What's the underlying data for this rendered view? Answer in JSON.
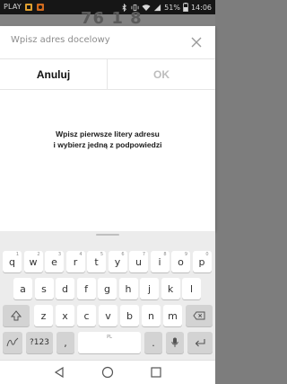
{
  "status_bar": {
    "carrier": "PLAY",
    "battery": "51%",
    "time": "14:06"
  },
  "background_app": {
    "partial_text": "76 1 8"
  },
  "dialog": {
    "input_placeholder": "Wpisz adres docelowy",
    "input_value": "",
    "cancel_label": "Anuluj",
    "ok_label": "OK",
    "hint_line1": "Wpisz pierwsze litery adresu",
    "hint_line2": "i wybierz jedną z podpowiedzi"
  },
  "keyboard": {
    "row1": [
      {
        "k": "q",
        "n": "1"
      },
      {
        "k": "w",
        "n": "2"
      },
      {
        "k": "e",
        "n": "3"
      },
      {
        "k": "r",
        "n": "4"
      },
      {
        "k": "t",
        "n": "5"
      },
      {
        "k": "y",
        "n": "6"
      },
      {
        "k": "u",
        "n": "7"
      },
      {
        "k": "i",
        "n": "8"
      },
      {
        "k": "o",
        "n": "9"
      },
      {
        "k": "p",
        "n": "0"
      }
    ],
    "row2": [
      "a",
      "s",
      "d",
      "f",
      "g",
      "h",
      "j",
      "k",
      "l"
    ],
    "row3": [
      "z",
      "x",
      "c",
      "v",
      "b",
      "n",
      "m"
    ],
    "symbols_label": "?123",
    "comma": ",",
    "space_label": "PL",
    "period": "."
  }
}
